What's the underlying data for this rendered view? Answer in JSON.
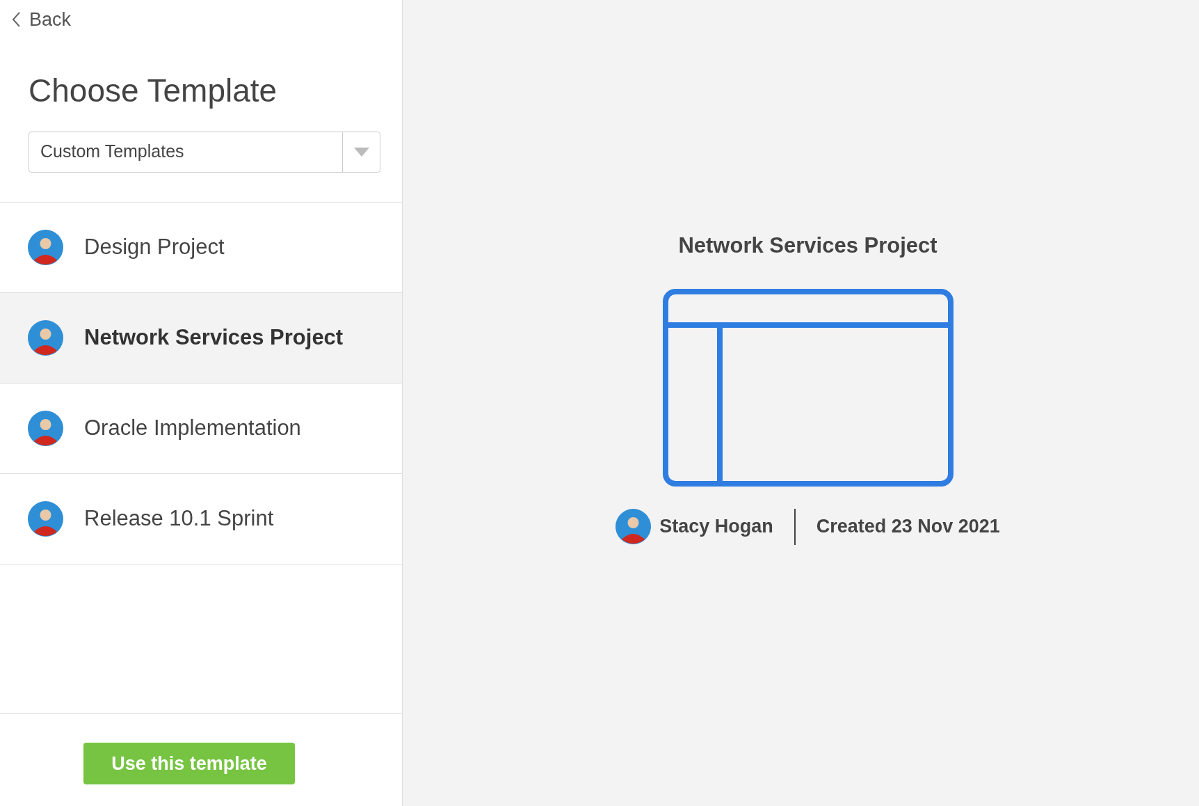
{
  "back": {
    "label": "Back"
  },
  "title": "Choose Template",
  "template_filter": {
    "value": "Custom Templates"
  },
  "templates": [
    {
      "name": "Design Project",
      "selected": false
    },
    {
      "name": "Network Services Project",
      "selected": true
    },
    {
      "name": "Oracle Implementation",
      "selected": false
    },
    {
      "name": "Release 10.1 Sprint",
      "selected": false
    }
  ],
  "preview": {
    "title": "Network Services Project",
    "author": "Stacy Hogan",
    "created": "Created 23 Nov 2021"
  },
  "primary_button": {
    "label": "Use this template"
  }
}
